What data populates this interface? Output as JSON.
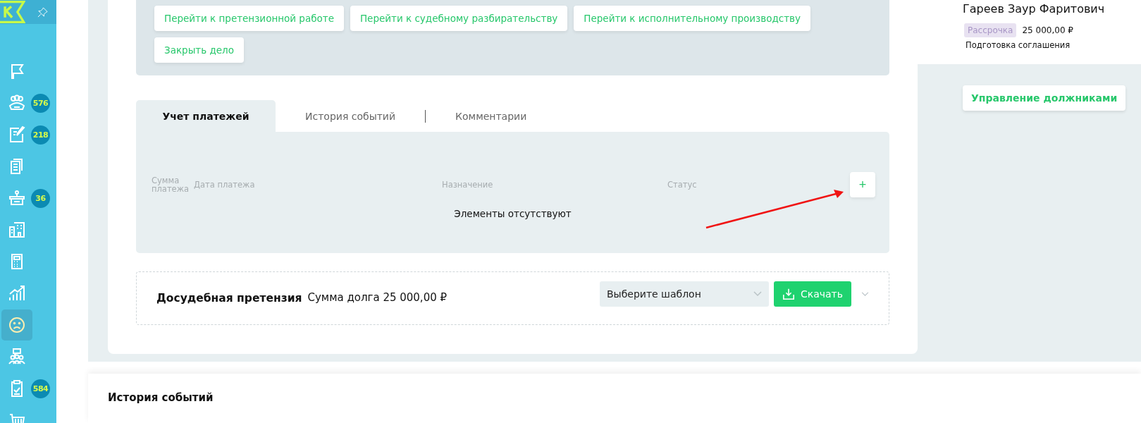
{
  "sidebar": {
    "items": [
      {
        "selected": false
      },
      {
        "badge": "576",
        "selected": false
      },
      {
        "badge": "218",
        "selected": false
      },
      {
        "selected": false
      },
      {
        "badge": "36",
        "selected": false
      },
      {
        "selected": false
      },
      {
        "selected": false
      },
      {
        "selected": false
      },
      {
        "selected": true
      },
      {
        "selected": false
      },
      {
        "badge": "584",
        "selected": false
      },
      {
        "selected": false
      }
    ]
  },
  "actions": [
    "Перейти к претензионной работе",
    "Перейти к судебному разбирательству",
    "Перейти к исполнительному производству",
    "Закрыть дело"
  ],
  "tabs": [
    {
      "label": "Учет платежей",
      "selected": true
    },
    {
      "label": "История событий",
      "selected": false
    },
    {
      "label": "Комментарии",
      "selected": false
    }
  ],
  "payments_table": {
    "columns": [
      "Сумма платежа",
      "Дата платежа",
      "Назначение",
      "Статус"
    ],
    "empty_text": "Элементы отсутствуют",
    "add_button": "+"
  },
  "claim": {
    "title": "Досудебная претензия",
    "debt": "Сумма долга 25 000,00 ₽",
    "template_select": {
      "placeholder": "Выберите шаблон"
    },
    "download_button": "Скачать"
  },
  "debtor": {
    "name": "Гареев Заур Фаритович",
    "tag": "Рассрочка",
    "amount": "25 000,00 ₽",
    "stage": "Подготовка соглашения"
  },
  "manage_button": "Управление должниками",
  "history": {
    "title": "История событий"
  }
}
